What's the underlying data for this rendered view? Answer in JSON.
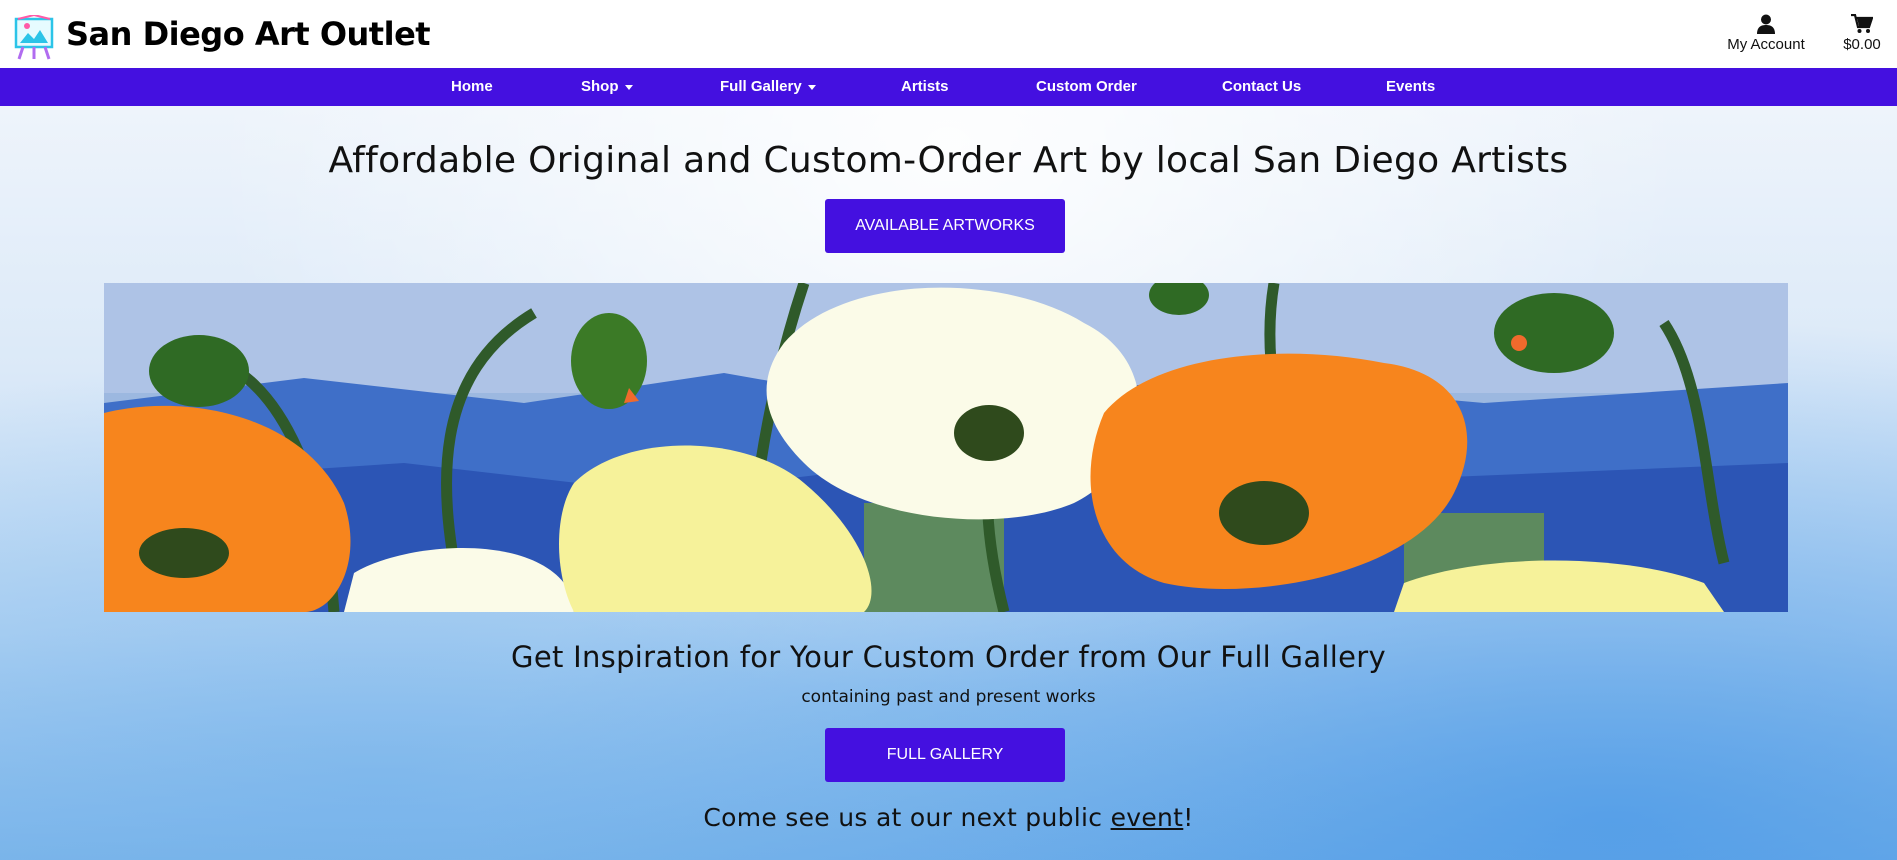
{
  "header": {
    "brand": "San Diego Art Outlet",
    "account_label": "My Account",
    "cart_total": "$0.00",
    "icons": [
      "easel-logo-icon",
      "user-icon",
      "cart-icon"
    ]
  },
  "nav": {
    "items": [
      {
        "label": "Home",
        "dropdown": false
      },
      {
        "label": "Shop",
        "dropdown": true
      },
      {
        "label": "Full Gallery",
        "dropdown": true
      },
      {
        "label": "Artists",
        "dropdown": false
      },
      {
        "label": "Custom Order",
        "dropdown": false
      },
      {
        "label": "Contact Us",
        "dropdown": false
      },
      {
        "label": "Events",
        "dropdown": false
      }
    ]
  },
  "main": {
    "headline": "Affordable Original and Custom-Order Art by local San Diego Artists",
    "artworks_button": "AVAILABLE ARTWORKS",
    "gallery_heading": "Get Inspiration for Your Custom Order from Our Full Gallery",
    "gallery_subheading": "containing past and present works",
    "gallery_button": "FULL GALLERY",
    "event_prefix": "Come see us at our next public ",
    "event_link": "event",
    "event_suffix": "!"
  },
  "colors": {
    "brand_purple": "#4410e0",
    "poppy_orange": "#f7851d",
    "poppy_yellow": "#f6f29a",
    "poppy_white": "#fbfbe8"
  }
}
